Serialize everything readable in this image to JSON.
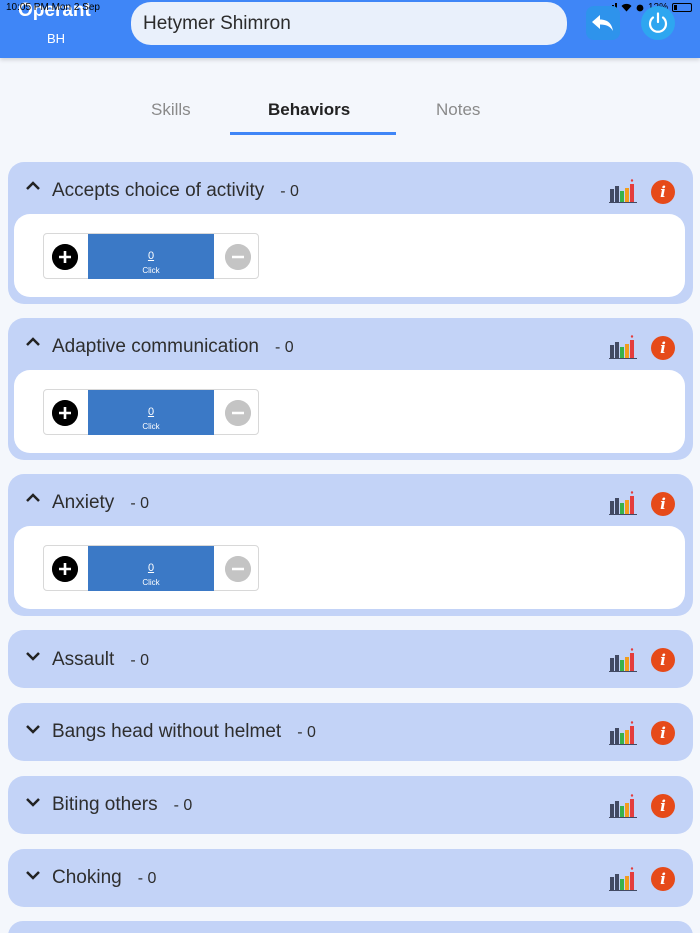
{
  "status_bar": {
    "time": "10:05 PM",
    "date": "Mon 2 Sep",
    "battery": "12%"
  },
  "header": {
    "brand": "Operant",
    "brand_sub": "BH",
    "search_value": "Hetymer Shimron"
  },
  "tabs": [
    {
      "label": "Skills",
      "active": false
    },
    {
      "label": "Behaviors",
      "active": true
    },
    {
      "label": "Notes",
      "active": false
    }
  ],
  "behaviors": [
    {
      "name": "Accepts choice of activity",
      "count": "- 0",
      "expanded": true,
      "counter_value": "0",
      "counter_label": "Click"
    },
    {
      "name": "Adaptive communication",
      "count": "- 0",
      "expanded": true,
      "counter_value": "0",
      "counter_label": "Click"
    },
    {
      "name": "Anxiety",
      "count": "- 0",
      "expanded": true,
      "counter_value": "0",
      "counter_label": "Click"
    },
    {
      "name": "Assault",
      "count": "- 0",
      "expanded": false
    },
    {
      "name": "Bangs head without helmet",
      "count": "- 0",
      "expanded": false
    },
    {
      "name": "Biting others",
      "count": "- 0",
      "expanded": false
    },
    {
      "name": "Choking",
      "count": "- 0",
      "expanded": false
    }
  ],
  "icons": {
    "back": "back-arrow-icon",
    "power": "power-icon",
    "chart": "bar-chart-icon",
    "info": "info-icon",
    "plus": "plus-icon",
    "minus": "minus-icon"
  },
  "colors": {
    "header": "#3f86f7",
    "card": "#c3d3f7",
    "counter": "#3b79c6",
    "info": "#e64a19"
  }
}
